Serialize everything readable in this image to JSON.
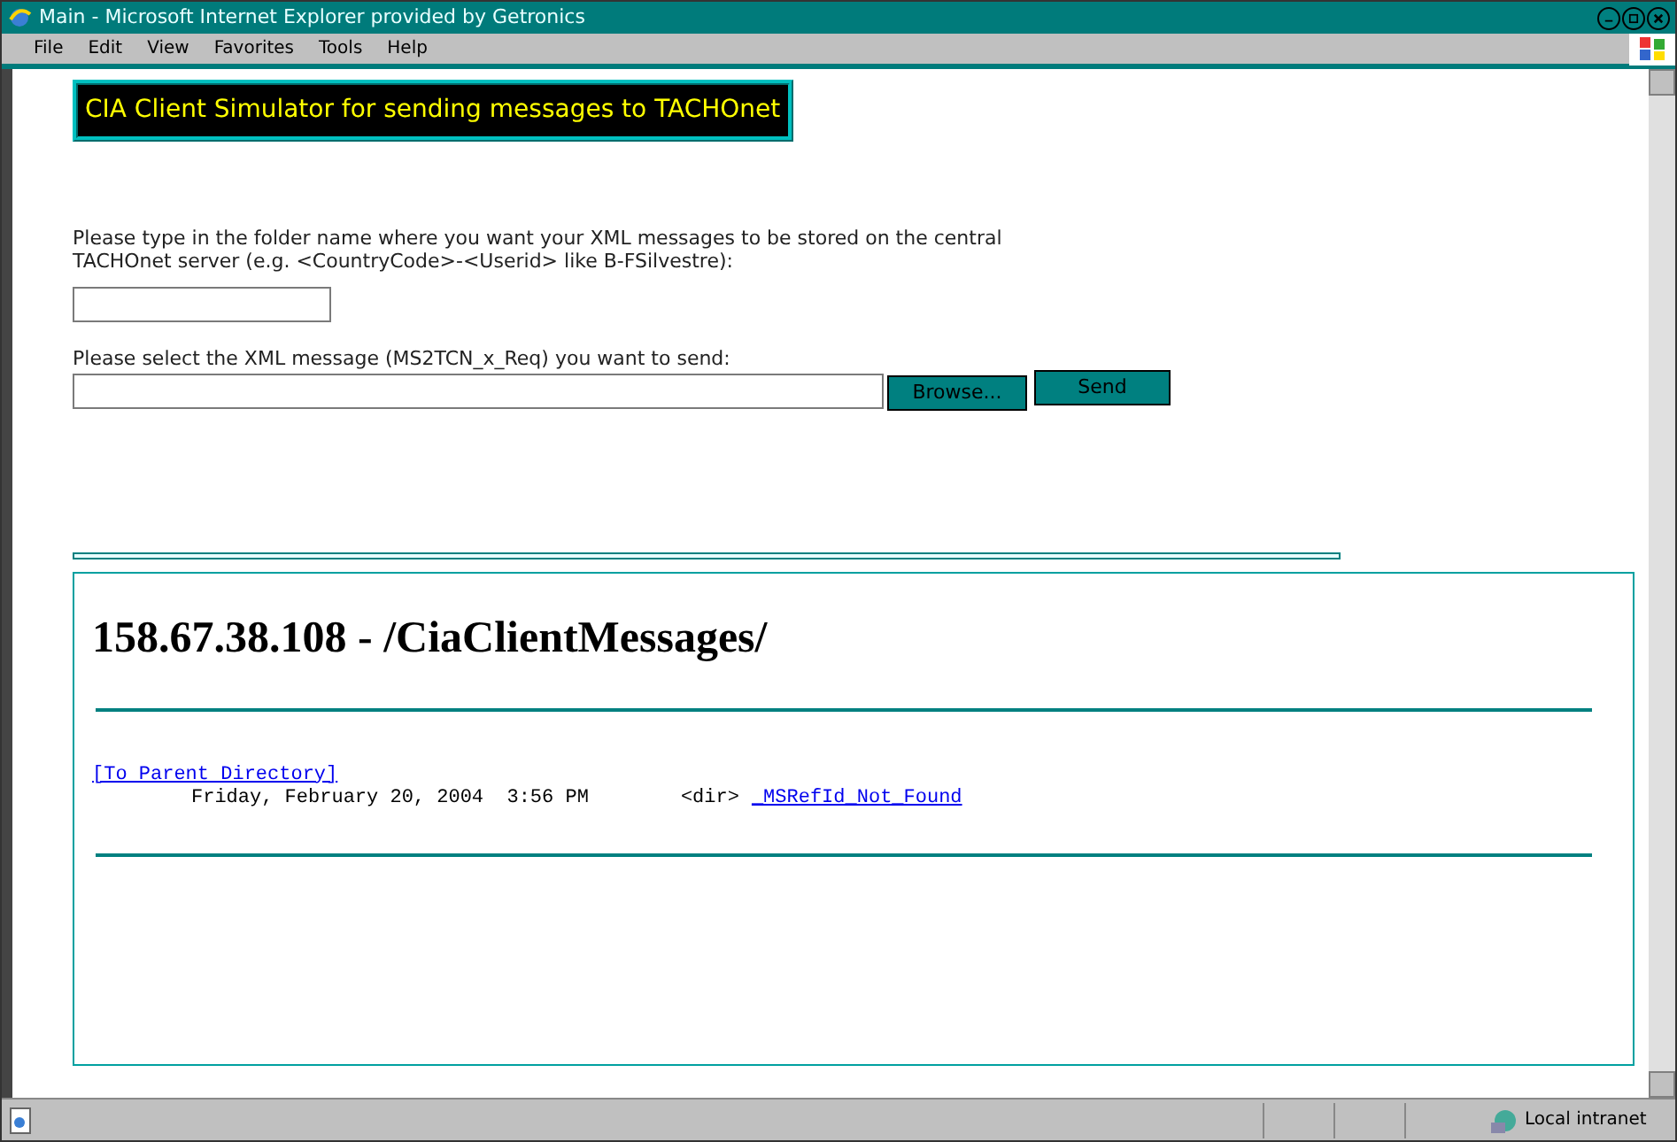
{
  "window": {
    "title": "Main - Microsoft Internet Explorer provided by Getronics"
  },
  "menu": [
    "File",
    "Edit",
    "View",
    "Favorites",
    "Tools",
    "Help"
  ],
  "form": {
    "banner": "CIA Client Simulator for sending messages to TACHOnet",
    "folder_prompt": "Please type in the folder name where you want your XML messages to be stored on the central TACHOnet server (e.g. <CountryCode>-<Userid> like B-FSilvestre):",
    "file_prompt": "Please select the XML message (MS2TCN_x_Req) you want to send:",
    "browse_button": "Browse...",
    "send_button": "Send"
  },
  "listing": {
    "heading": "158.67.38.108 - /CiaClientMessages/",
    "parent_link": "[To Parent Directory]",
    "entries": [
      {
        "date": "Friday, February 20, 2004  3:56 PM",
        "type": "<dir>",
        "name": "_MSRefId_Not_Found"
      }
    ]
  },
  "status_bar": {
    "zone": "Local intranet"
  }
}
